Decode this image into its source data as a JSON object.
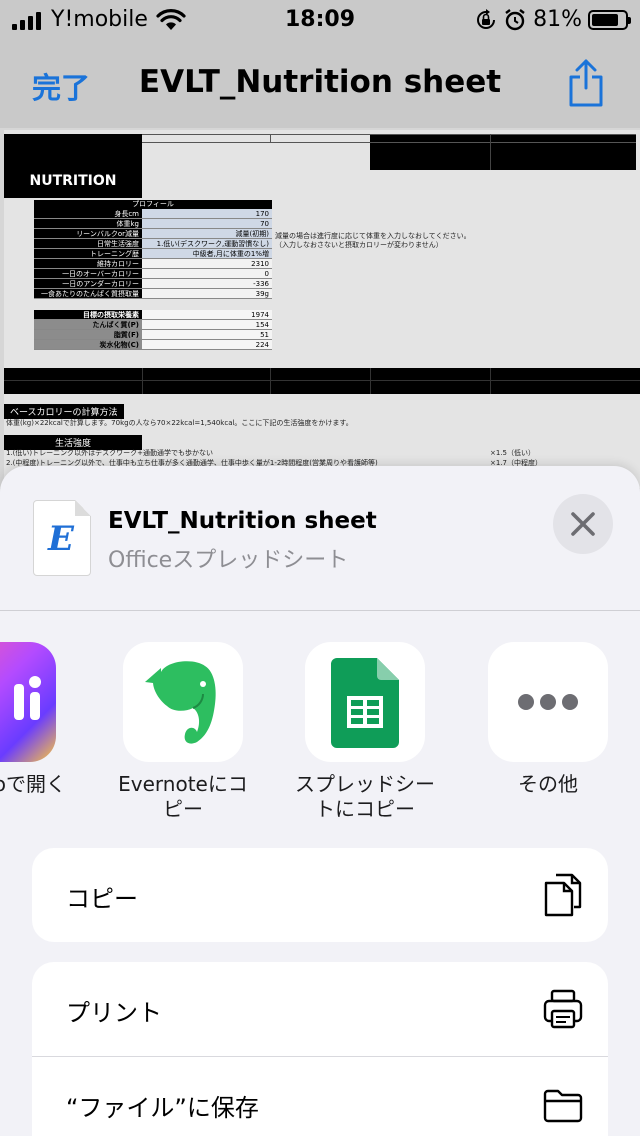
{
  "status_bar": {
    "carrier": "Y!mobile",
    "time": "18:09",
    "battery_percent": "81%",
    "battery_level": 0.81
  },
  "nav": {
    "done_label": "完了",
    "title": "EVLT_Nutrition sheet",
    "share_icon": "share-icon"
  },
  "sheet": {
    "title": "NUTRITION",
    "profile_header": "プロフィール",
    "profile_rows": [
      {
        "label": "身長cm",
        "value": "170"
      },
      {
        "label": "体重kg",
        "value": "70"
      },
      {
        "label": "リーンバルクor減量",
        "value": "減量(初期)"
      },
      {
        "label": "日常生活強度",
        "value": "1.低い(デスクワーク,運動習慣なし)"
      },
      {
        "label": "トレーニング歴",
        "value": "中級者,月に体重の1%増"
      },
      {
        "label": "維持カロリー",
        "value": "2310"
      },
      {
        "label": "一日のオーバーカロリー",
        "value": "0"
      },
      {
        "label": "一日のアンダーカロリー",
        "value": "-336"
      },
      {
        "label": "一食あたりのたんぱく質摂取量",
        "value": "39g"
      }
    ],
    "profile_note_1": "減量の場合は進行度に応じて体重を入力しなおしてください。",
    "profile_note_2": "（入力しなおさないと摂取カロリーが変わりません）",
    "goal_rows": [
      {
        "label": "目標の摂取栄養素",
        "value": "1974"
      },
      {
        "label": "たんぱく質(P)",
        "value": "154"
      },
      {
        "label": "脂質(F)",
        "value": "51"
      },
      {
        "label": "炭水化物(C)",
        "value": "224"
      }
    ],
    "base_calorie_heading": "ベースカロリーの計算方法",
    "base_calorie_text": "体重(kg)×22kcalで計算します。70kgの人なら70×22kcal=1,540kcal。ここに下記の生活強度をかけます。",
    "life_intensity_heading": "生活強度",
    "life_line_1": "1.(低い)トレーニング以外はデスクワーク+通勤通学でも歩かない",
    "life_line_1_factor": "×1.5（低い）",
    "life_line_2": "2.(中程度)トレーニング以外で、仕事中も立ち仕事が多く通勤通学、仕事中歩く量が1-2時間程度(営業周りや看護師等)",
    "life_line_2_factor": "×1.7（中程度）"
  },
  "share_sheet": {
    "file_name": "EVLT_Nutrition sheet",
    "file_type": "Officeスプレッドシート",
    "doc_letter": "E",
    "apps": [
      {
        "label": "oで開く",
        "icon": "app-icon-partial"
      },
      {
        "label": "Evernoteにコピー",
        "icon": "evernote-icon"
      },
      {
        "label": "スプレッドシートにコピー",
        "icon": "google-sheets-icon"
      },
      {
        "label": "その他",
        "icon": "more-icon"
      }
    ],
    "actions_group_1": [
      {
        "label": "コピー",
        "icon": "copy-icon"
      }
    ],
    "actions_group_2": [
      {
        "label": "プリント",
        "icon": "print-icon"
      },
      {
        "label": "“ファイル”に保存",
        "icon": "folder-icon"
      }
    ],
    "accent_color": "#1a73d9"
  }
}
